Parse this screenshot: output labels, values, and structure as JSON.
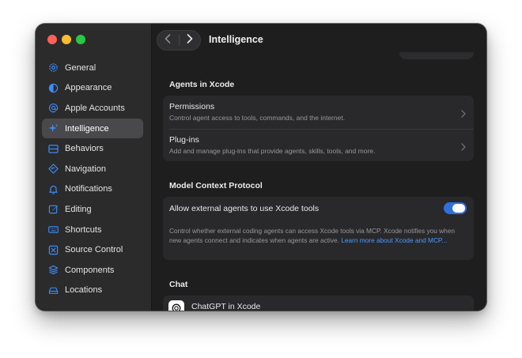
{
  "window": {
    "title": "Intelligence"
  },
  "sidebar": {
    "items": [
      {
        "label": "General",
        "icon": "gear-icon"
      },
      {
        "label": "Appearance",
        "icon": "appearance-icon"
      },
      {
        "label": "Apple Accounts",
        "icon": "at-sign-icon"
      },
      {
        "label": "Intelligence",
        "icon": "sparkle-icon",
        "selected": true
      },
      {
        "label": "Behaviors",
        "icon": "behaviors-icon"
      },
      {
        "label": "Navigation",
        "icon": "navigation-icon"
      },
      {
        "label": "Notifications",
        "icon": "bell-icon"
      },
      {
        "label": "Editing",
        "icon": "edit-icon"
      },
      {
        "label": "Shortcuts",
        "icon": "keyboard-icon"
      },
      {
        "label": "Source Control",
        "icon": "source-control-icon"
      },
      {
        "label": "Components",
        "icon": "components-icon"
      },
      {
        "label": "Locations",
        "icon": "drive-icon"
      }
    ]
  },
  "agents": {
    "heading": "Agents in Xcode",
    "permissions": {
      "title": "Permissions",
      "subtitle": "Control agent access to tools, commands, and the internet."
    },
    "plugins": {
      "title": "Plug-ins",
      "subtitle": "Add and manage plug-ins that provide agents, skills, tools, and more."
    }
  },
  "mcp": {
    "heading": "Model Context Protocol",
    "toggle_label": "Allow external agents to use Xcode tools",
    "toggle_on": true,
    "description": "Control whether external coding agents can access Xcode tools via MCP. Xcode notifies you when new agents connect and indicates when agents are active.",
    "link_text": "Learn more about Xcode and MCP..."
  },
  "chat": {
    "heading": "Chat",
    "provider_label": "ChatGPT in Xcode",
    "provider_icon": "chatgpt-logo-icon"
  },
  "colors": {
    "accent": "#3d8bf6",
    "toggle": "#2f6fe0",
    "link": "#4a9bff",
    "window_bg": "#1e1e1f",
    "sidebar_bg": "#2b2b2c"
  }
}
